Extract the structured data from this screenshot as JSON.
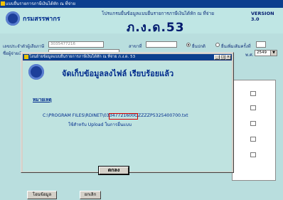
{
  "main": {
    "title": "แบบยื่นรายการภาษีเงินได้หัก ณ ที่จ่าย",
    "dept_name": "กรมสรรพากร",
    "subtitle": "โปรแกรมยื่นข้อมูลแบบยื่นรายการภาษีเงินได้หัก ณ ที่จ่าย",
    "form_code": "ภ.ง.ด.53",
    "version": "VERSION 3.0",
    "tax_id_label": "เลขประจำตัวผู้เสียภาษี",
    "tax_id_value": "3035477216",
    "branch_label": "สาขาที่",
    "radio_normal": "ยื่นปกติ",
    "radio_extra": "ยื่นเพิ่มเติมครั้งที่",
    "payer_name_label": "ชื่อผู้จ่ายเงิน",
    "year_label": "พ.ศ.",
    "year_value": "2549",
    "bottom_btn1": "โอนข้อมูล",
    "bottom_btn2": "ยกเลิก",
    "dropdown_arrow": "▼"
  },
  "dialog": {
    "title": "โอนย้ายข้อมูลแบบยื่นรายการภาษีเงินได้หัก ณ ที่จ่าย ภ.ง.ด. 53",
    "heading": "จัดเก็บข้อมูลลงไฟล์ เรียบร้อยแล้ว",
    "note_label": "หมายเหตุ",
    "path_prefix": "C:\\PROGRAM FILES\\RDINET\\",
    "path_highlight": "0334772160",
    "path_suffix": "0OZZZZP5325400700.txt",
    "usage_text": "ใช้สำหรับ Upload ในการยื่นแบบ",
    "ok_label": "ตกลง",
    "minimize": "_",
    "maximize": "□",
    "close": "×"
  }
}
